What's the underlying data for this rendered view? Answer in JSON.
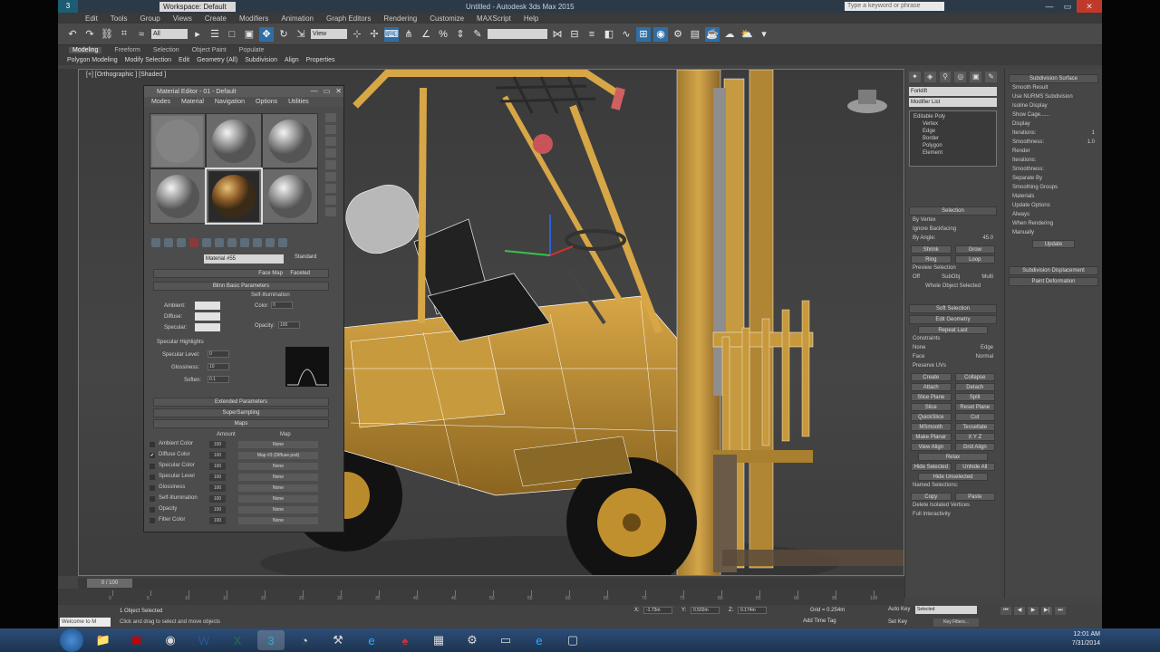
{
  "app": {
    "workspace": "Workspace: Default",
    "window_title": "Untitled - Autodesk 3ds Max 2015",
    "search_placeholder": "Type a keyword or phrase",
    "menu": [
      "Edit",
      "Tools",
      "Group",
      "Views",
      "Create",
      "Modifiers",
      "Animation",
      "Graph Editors",
      "Rendering",
      "Customize",
      "MAXScript",
      "Help"
    ]
  },
  "toolbar": {
    "filter": "All",
    "view": "View"
  },
  "ribbon": {
    "tabs": [
      "Modeling",
      "Freeform",
      "Selection",
      "Object Paint",
      "Populate"
    ],
    "items": [
      "Polygon Modeling",
      "Modify Selection",
      "Edit",
      "Geometry (All)",
      "Subdivision",
      "Align",
      "Properties"
    ]
  },
  "viewport": {
    "label": "[+] [Orthographic ] [Shaded ]"
  },
  "material_editor": {
    "title": "Material Editor - 01 - Default",
    "menu": [
      "Modes",
      "Material",
      "Navigation",
      "Options",
      "Utilities"
    ],
    "material_name": "Material #55",
    "material_type": "Standard",
    "rollouts": {
      "face_map": "Face Map",
      "faceted": "Faceted",
      "blinn": "Blinn Basic Parameters",
      "self_illum": "Self-Illumination",
      "ambient": "Ambient:",
      "diffuse": "Diffuse:",
      "specular": "Specular:",
      "color": "Color",
      "opacity": "Opacity:",
      "spec_hl": "Specular Highlights",
      "spec_level": "Specular Level:",
      "glossiness": "Glossiness:",
      "soften": "Soften:",
      "extended": "Extended Parameters",
      "supersampling": "SuperSampling",
      "maps": "Maps",
      "amount": "Amount",
      "map": "Map"
    },
    "spinner_vals": {
      "color": "0",
      "opacity": "100",
      "spec_level": "0",
      "glossiness": "10",
      "soften": "0.1"
    },
    "maps": [
      {
        "name": "Ambient Color",
        "amount": "100",
        "map": "None",
        "checked": false
      },
      {
        "name": "Diffuse Color",
        "amount": "100",
        "map": "Map #3 (Diffuse.psd)",
        "checked": true
      },
      {
        "name": "Specular Color",
        "amount": "100",
        "map": "None",
        "checked": false
      },
      {
        "name": "Specular Level",
        "amount": "100",
        "map": "None",
        "checked": false
      },
      {
        "name": "Glossiness",
        "amount": "100",
        "map": "None",
        "checked": false
      },
      {
        "name": "Self-Illumination",
        "amount": "100",
        "map": "None",
        "checked": false
      },
      {
        "name": "Opacity",
        "amount": "100",
        "map": "None",
        "checked": false
      },
      {
        "name": "Filter Color",
        "amount": "100",
        "map": "None",
        "checked": false
      }
    ]
  },
  "command_panel": {
    "object_name": "Forklift",
    "modifier_list": "Modifier List",
    "stack": [
      "Editable Poly",
      "Vertex",
      "Edge",
      "Border",
      "Polygon",
      "Element"
    ],
    "selection": "Selection",
    "by_vertex": "By Vertex",
    "ignore_backfacing": "Ignore Backfacing",
    "by_angle": "By Angle:",
    "by_angle_val": "45.0",
    "shrink": "Shrink",
    "grow": "Grow",
    "ring": "Ring",
    "loop": "Loop",
    "preview": "Preview Selection",
    "off": "Off",
    "subobj": "SubObj",
    "multi": "Multi",
    "whole_object": "Whole Object Selected",
    "soft_selection": "Soft Selection",
    "edit_geometry": "Edit Geometry",
    "repeat_last": "Repeat Last",
    "constraints": "Constraints",
    "none": "None",
    "edge": "Edge",
    "face": "Face",
    "normal": "Normal",
    "preserve_uvs": "Preserve UVs",
    "create": "Create",
    "collapse": "Collapse",
    "attach": "Attach",
    "detach": "Detach",
    "slice_plane": "Slice Plane",
    "split": "Split",
    "slice": "Slice",
    "reset_plane": "Reset Plane",
    "quickslice": "QuickSlice",
    "cut": "Cut",
    "msmooth": "MSmooth",
    "tessellate": "Tessellate",
    "make_planar": "Make Planar",
    "xyz": "X  Y  Z",
    "view_align": "View Align",
    "grid_align": "Grid Align",
    "relax": "Relax",
    "hide_selected": "Hide Selected",
    "unhide_all": "Unhide All",
    "hide_unselected": "Hide Unselected",
    "named_sel": "Named Selections:",
    "copy": "Copy",
    "paste": "Paste",
    "delete_isolated": "Delete Isolated Vertices",
    "full_interactivity": "Full Interactivity"
  },
  "command_panel_2": {
    "subdiv_surface": "Subdivision Surface",
    "smooth_result": "Smooth Result",
    "use_nurms": "Use NURMS Subdivision",
    "isoline": "Isoline Display",
    "show_cage": "Show Cage......",
    "display": "Display",
    "iterations": "Iterations:",
    "iter_val": "1",
    "smoothness": "Smoothness:",
    "smooth_val": "1.0",
    "render": "Render",
    "separate_by": "Separate By",
    "smoothing_groups": "Smoothing Groups",
    "materials": "Materials",
    "update_options": "Update Options",
    "always": "Always",
    "when_rendering": "When Rendering",
    "manually": "Manually",
    "update": "Update",
    "subdiv_disp": "Subdivision Displacement",
    "paint_def": "Paint Deformation"
  },
  "timeline": {
    "slider": "0 / 100",
    "ticks": [
      "0",
      "5",
      "10",
      "15",
      "20",
      "25",
      "30",
      "35",
      "40",
      "45",
      "50",
      "55",
      "60",
      "65",
      "70",
      "75",
      "80",
      "85",
      "90",
      "95",
      "100"
    ]
  },
  "status": {
    "maxscript": "Welcome to M",
    "line1": "1 Object Selected",
    "line2": "Click and drag to select and move objects",
    "x": "X:",
    "x_val": "-1.73m",
    "y": "Y:",
    "y_val": "0.502m",
    "z": "Z:",
    "z_val": "0.174m",
    "grid": "Grid = 0.254m",
    "add_time_tag": "Add Time Tag",
    "auto_key": "Auto Key",
    "selected": "Selected",
    "set_key": "Set Key",
    "key_filters": "Key Filters..."
  },
  "taskbar": {
    "time": "12:01 AM",
    "date": "7/31/2014",
    "apps": [
      "folder-icon",
      "pdf-icon",
      "chrome-icon",
      "word-icon",
      "excel-icon",
      "3dsmax-icon",
      "firefox-icon",
      "tool-icon",
      "ie-icon",
      "game-icon",
      "photos-icon",
      "steam-icon",
      "explorer-icon",
      "ie2-icon",
      "chat-icon"
    ]
  }
}
